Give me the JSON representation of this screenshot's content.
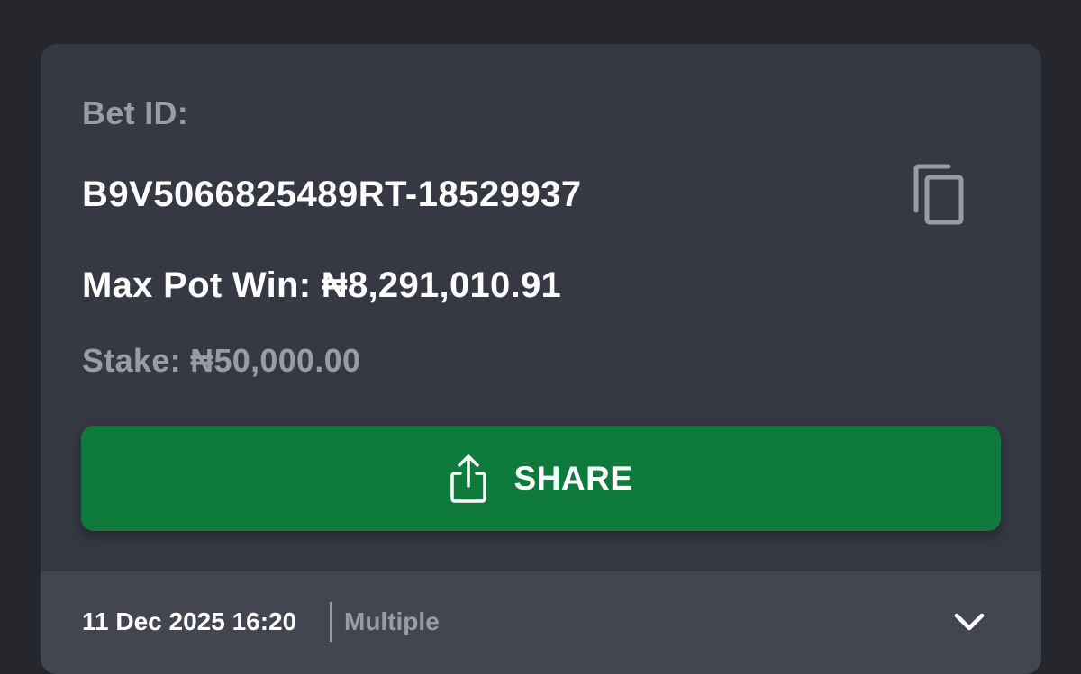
{
  "bet": {
    "id_label": "Bet ID:",
    "id_value": "B9V5066825489RT-18529937",
    "max_pot_win": "Max Pot Win: ₦8,291,010.91",
    "stake": "Stake: ₦50,000.00"
  },
  "share_button": {
    "label": "SHARE",
    "icon": "share-icon"
  },
  "copy_button": {
    "icon": "copy-icon"
  },
  "footer": {
    "datetime": "11 Dec 2025 16:20",
    "bet_type": "Multiple",
    "expand_icon": "chevron-down-icon"
  },
  "colors": {
    "background": "#25272c",
    "card": "#363843",
    "footer": "#434551",
    "accent_green": "#0e7a3c",
    "muted_text": "#9a9ca5",
    "primary_text": "#ffffff"
  }
}
